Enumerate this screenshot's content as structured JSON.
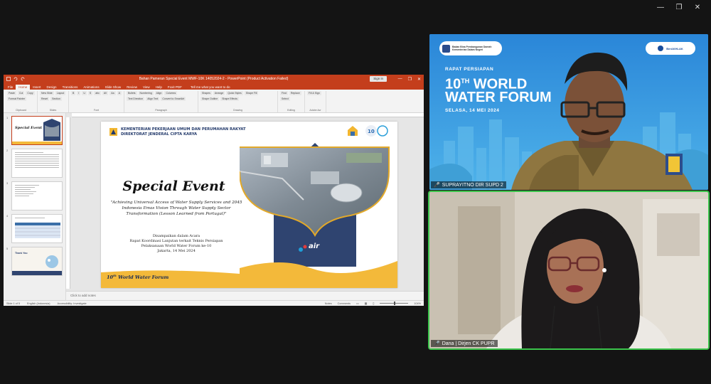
{
  "window": {
    "controls": [
      "—",
      "❐",
      "✕"
    ]
  },
  "ppt": {
    "doc_title": "Bahan Pameran Special Event MWF-10K 14052024-2 - PowerPoint (Product Activation Failed)",
    "sign_in": "Sign in",
    "tabs": [
      "File",
      "Home",
      "Insert",
      "Design",
      "Transitions",
      "Animations",
      "Slide Show",
      "Review",
      "View",
      "Help",
      "Foxit PDF"
    ],
    "tell_me": "Tell me what you want to do",
    "ribbon_groups": [
      {
        "label": "Clipboard",
        "buttons": [
          "Paste",
          "Cut",
          "Copy",
          "Format Painter"
        ]
      },
      {
        "label": "Slides",
        "buttons": [
          "New Slide",
          "Layout",
          "Reset",
          "Section"
        ]
      },
      {
        "label": "Font",
        "buttons": [
          "B",
          "I",
          "U",
          "S",
          "abc",
          "AV",
          "Aa",
          "A"
        ]
      },
      {
        "label": "Paragraph",
        "buttons": [
          "Bullets",
          "Numbering",
          "Align",
          "Columns",
          "Text Direction",
          "Align Text",
          "Convert to SmartArt"
        ]
      },
      {
        "label": "Drawing",
        "buttons": [
          "Shapes",
          "Arrange",
          "Quick Styles",
          "Shape Fill",
          "Shape Outline",
          "Shape Effects"
        ]
      },
      {
        "label": "Editing",
        "buttons": [
          "Find",
          "Replace",
          "Select"
        ]
      },
      {
        "label": "Adobe Acr",
        "buttons": [
          "Fill & Sign"
        ]
      }
    ],
    "slide_numbers": [
      "1",
      "2",
      "3",
      "4",
      "5"
    ],
    "notes_placeholder": "Click to add notes",
    "status": {
      "slide_of": "Slide 1 of 5",
      "language": "English (Indonesia)",
      "accessibility": "Accessibility: Investigate",
      "notes": "Notes",
      "comments": "Comments",
      "zoom": "104%"
    },
    "slide": {
      "org_line1": "KEMENTERIAN PEKERJAAN UMUM DAN PERUMAHAN RAKYAT",
      "org_line2": "DIREKTORAT JENDERAL CIPTA KARYA",
      "title": "Special Event",
      "subtitle": "\"Achieving Universal Access of Water Supply Services and 2045 Indonesia Emas Vision Through Water Supply Sector Transformation (Lesson Learned from Portugal)\"",
      "pres_line1": "Disampaikan dalam Acara",
      "pres_line2": "Rapat Koordinasi Lanjutan terkait Teknis Persiapan",
      "pres_line3": "Pelaksanaan World Water Forum ke-10",
      "pres_line4": "Jakarta, 14 Mei 2024",
      "footer_num": "10",
      "footer_sup": "th",
      "footer_rest": " World Water Forum",
      "air_logo": "air"
    },
    "thumb5_title": "Thank You"
  },
  "tile1": {
    "bg_org_line1": "Badan Bina Pembangunan Daerah",
    "bg_org_line2": "Kementerian Dalam Negeri",
    "bg_right_logo": "BerAKHLAK",
    "event_small": "RAPAT PERSIAPAN",
    "event_num": "10",
    "event_sup": "TH",
    "event_big1_rest": " WORLD",
    "event_big2": "WATER FORUM",
    "event_date": "SELASA, 14 MEI 2024",
    "participant": "SUPRAYITNO DIR SUPD 2"
  },
  "tile2": {
    "participant": "Dana | Dirjen CK PUPR"
  },
  "colors": {
    "ppt_accent": "#c43e1c",
    "slide_navy": "#233a6b",
    "slide_yellow": "#f3b93a",
    "tile_blue": "#2b7fd1",
    "active_speaker": "#3bc44b"
  }
}
